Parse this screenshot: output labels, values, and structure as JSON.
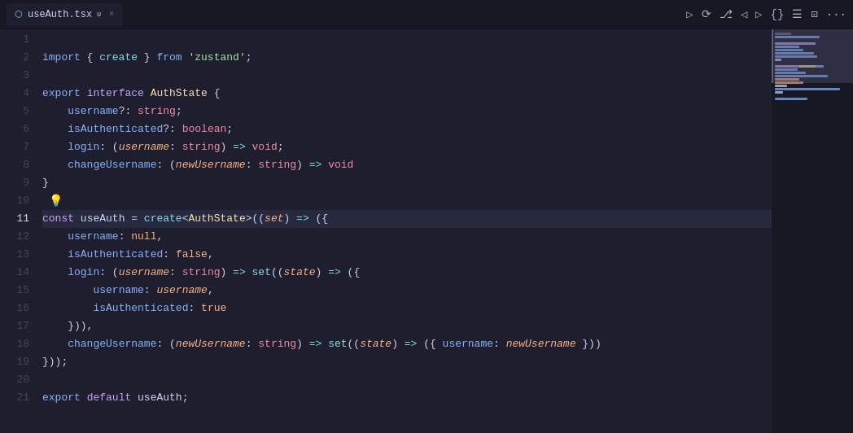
{
  "tab": {
    "icon": "⬡",
    "filename": "useAuth.tsx",
    "modified_indicator": "U",
    "close": "×"
  },
  "toolbar": {
    "run_icon": "▷",
    "history_icon": "↺",
    "branch_icon": "⎇",
    "back_icon": "◁",
    "forward_icon": "▷",
    "braces_icon": "{}",
    "list_icon": "≡",
    "split_icon": "⊡",
    "more_icon": "···"
  },
  "lines": [
    {
      "num": 1,
      "content": ""
    },
    {
      "num": 2,
      "content": "import { create } from 'zustand';"
    },
    {
      "num": 3,
      "content": ""
    },
    {
      "num": 4,
      "content": "export interface AuthState {"
    },
    {
      "num": 5,
      "content": "  username?: string;"
    },
    {
      "num": 6,
      "content": "  isAuthenticated?: boolean;"
    },
    {
      "num": 7,
      "content": "  login: (username: string) => void;"
    },
    {
      "num": 8,
      "content": "  changeUsername: (newUsername: string) => void"
    },
    {
      "num": 9,
      "content": "}"
    },
    {
      "num": 10,
      "content": ""
    },
    {
      "num": 11,
      "content": "const useAuth = create<AuthState>((set) => ({"
    },
    {
      "num": 12,
      "content": "  username: null,"
    },
    {
      "num": 13,
      "content": "  isAuthenticated: false,"
    },
    {
      "num": 14,
      "content": "  login: (username: string) => set((state) => ({"
    },
    {
      "num": 15,
      "content": "    username: username,"
    },
    {
      "num": 16,
      "content": "    isAuthenticated: true"
    },
    {
      "num": 17,
      "content": "  })),"
    },
    {
      "num": 18,
      "content": "  changeUsername: (newUsername: string) => set((state) => ({ username: newUsername }))"
    },
    {
      "num": 19,
      "content": "}));"
    },
    {
      "num": 20,
      "content": ""
    },
    {
      "num": 21,
      "content": "export default useAuth;"
    }
  ]
}
